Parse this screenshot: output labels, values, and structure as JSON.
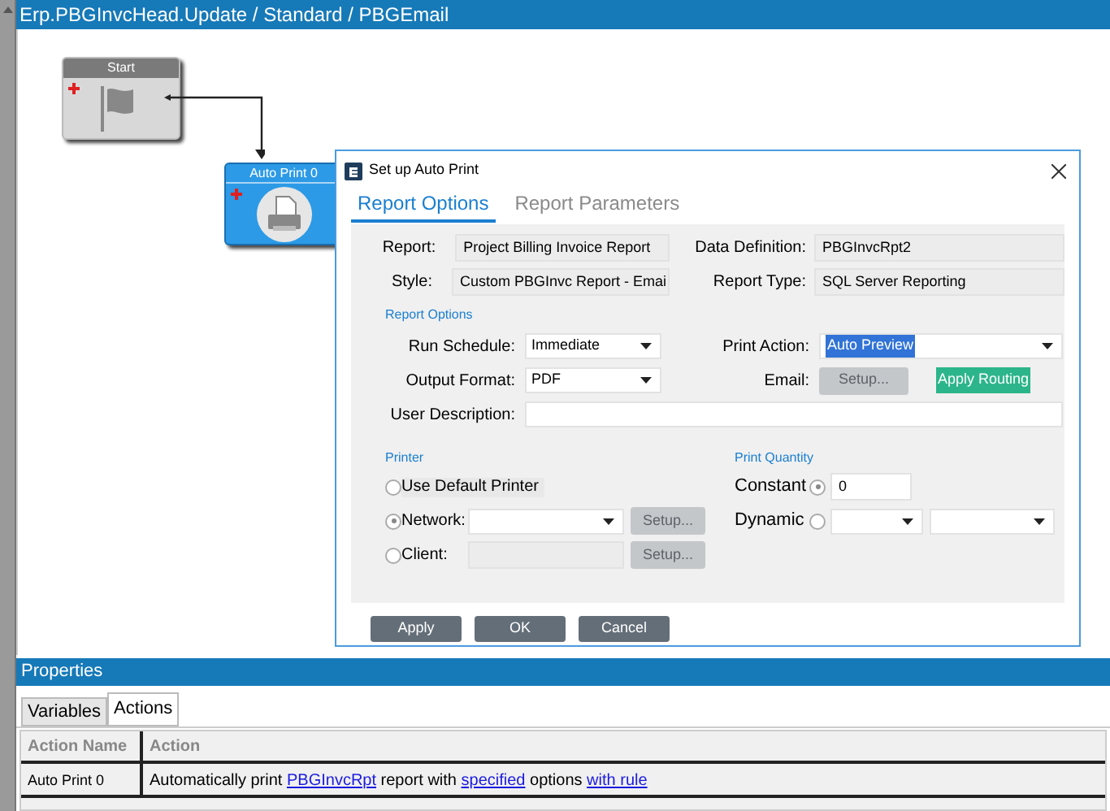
{
  "window": {
    "title": "Erp.PBGInvcHead.Update / Standard / PBGEmail"
  },
  "nodes": [
    {
      "kind": "start",
      "label": "Start",
      "selected": false
    },
    {
      "kind": "print",
      "label": "Auto Print 0",
      "selected": true
    }
  ],
  "dialog": {
    "title": "Set up Auto Print",
    "tabs": [
      {
        "label": "Report Options",
        "selected": true
      },
      {
        "label": "Report Parameters",
        "selected": false
      }
    ],
    "report": {
      "label": "Report:",
      "value": "Project Billing Invoice Report"
    },
    "style": {
      "label": "Style:",
      "value": "Custom PBGInvc Report - Emai"
    },
    "data_definition": {
      "label": "Data Definition:",
      "value": "PBGInvcRpt2"
    },
    "report_type": {
      "label": "Report Type:",
      "value": "SQL Server Reporting"
    },
    "report_options_heading": "Report Options",
    "run_schedule": {
      "label": "Run Schedule:",
      "value": "Immediate"
    },
    "print_action": {
      "label": "Print Action:",
      "value": "Auto Preview"
    },
    "output_format": {
      "label": "Output Format:",
      "value": "PDF"
    },
    "email": {
      "label": "Email:",
      "setup_button": "Setup...",
      "routing_button": "Apply Routing"
    },
    "user_description": {
      "label": "User Description:"
    },
    "printer": {
      "heading": "Printer",
      "options": [
        {
          "kind": "plain",
          "label": "Use Default Printer",
          "selected": false
        },
        {
          "kind": "select",
          "label": "Network:",
          "selected": true,
          "button": "Setup..."
        },
        {
          "kind": "text",
          "label": "Client:",
          "selected": false,
          "button": "Setup..."
        }
      ]
    },
    "print_quantity": {
      "heading": "Print Quantity",
      "options": [
        {
          "kind": "number",
          "label": "Constant",
          "selected": true,
          "value": "0"
        },
        {
          "kind": "selects",
          "label": "Dynamic",
          "selected": false
        }
      ]
    },
    "buttons": [
      "Apply",
      "OK",
      "Cancel"
    ]
  },
  "properties": {
    "title": "Properties",
    "tabs": [
      {
        "label": "Variables",
        "selected": false
      },
      {
        "label": "Actions",
        "selected": true
      }
    ],
    "columns": [
      "Action Name",
      "Action"
    ],
    "rows": [
      {
        "name": "Auto Print 0",
        "action": [
          {
            "kind": "text",
            "text": "Automatically print "
          },
          {
            "kind": "link",
            "text": "PBGInvcRpt"
          },
          {
            "kind": "text",
            "text": " report with "
          },
          {
            "kind": "link",
            "text": "specified"
          },
          {
            "kind": "text",
            "text": " options "
          },
          {
            "kind": "link",
            "text": "with rule"
          }
        ]
      }
    ]
  }
}
